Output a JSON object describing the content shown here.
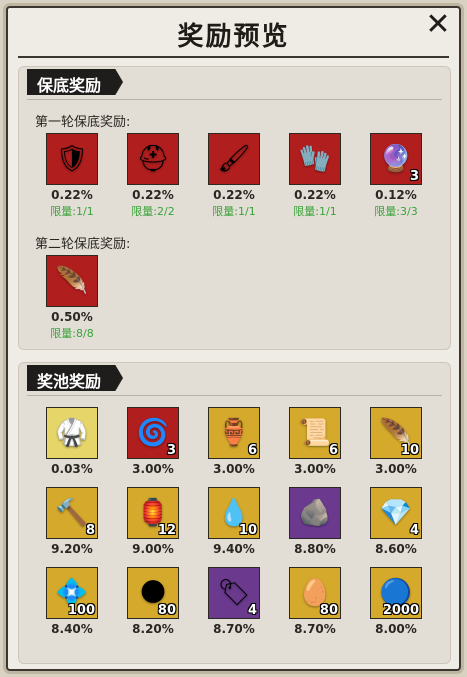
{
  "window": {
    "title": "奖励预览",
    "close_icon": "close-icon"
  },
  "guarantee": {
    "header": "保底奖励",
    "round1": {
      "label": "第一轮保底奖励:",
      "items": [
        {
          "icon": "armor-icon",
          "glyph": "🛡",
          "color": "#b01e1e",
          "count": "",
          "pct": "0.22%",
          "limit": "限量:1/1"
        },
        {
          "icon": "helmet-icon",
          "glyph": "⛑",
          "color": "#b01e1e",
          "count": "",
          "pct": "0.22%",
          "limit": "限量:2/2"
        },
        {
          "icon": "brush-icon",
          "glyph": "🖌",
          "color": "#b01e1e",
          "count": "",
          "pct": "0.22%",
          "limit": "限量:1/1"
        },
        {
          "icon": "gauntlet-icon",
          "glyph": "🧤",
          "color": "#b01e1e",
          "count": "",
          "pct": "0.22%",
          "limit": "限量:1/1"
        },
        {
          "icon": "orb-icon",
          "glyph": "🔮",
          "color": "#b01e1e",
          "count": "3",
          "pct": "0.12%",
          "limit": "限量:3/3"
        }
      ]
    },
    "round2": {
      "label": "第二轮保底奖励:",
      "items": [
        {
          "icon": "golden-wing-icon",
          "glyph": "🪶",
          "color": "#b01e1e",
          "count": "",
          "pct": "0.50%",
          "limit": "限量:8/8"
        }
      ]
    }
  },
  "pool": {
    "header": "奖池奖励",
    "items": [
      {
        "icon": "armor-set-icon",
        "glyph": "🥋",
        "color": "#e6d66a",
        "count": "",
        "pct": "0.03%"
      },
      {
        "icon": "swirl-token-icon",
        "glyph": "🌀",
        "color": "#b01e1e",
        "count": "3",
        "pct": "3.00%"
      },
      {
        "icon": "potion-jar-icon",
        "glyph": "🏺",
        "color": "#d4a92c",
        "count": "6",
        "pct": "3.00%"
      },
      {
        "icon": "scroll-ticket-icon",
        "glyph": "📜",
        "color": "#d4a92c",
        "count": "6",
        "pct": "3.00%"
      },
      {
        "icon": "gold-fragment-icon",
        "glyph": "🪶",
        "color": "#d4a92c",
        "count": "10",
        "pct": "3.00%"
      },
      {
        "icon": "hammer-icon",
        "glyph": "🔨",
        "color": "#d4a92c",
        "count": "8",
        "pct": "9.20%"
      },
      {
        "icon": "incense-pot-icon",
        "glyph": "🏮",
        "color": "#d4a92c",
        "count": "12",
        "pct": "9.00%"
      },
      {
        "icon": "spirit-flame-icon",
        "glyph": "💧",
        "color": "#d4a92c",
        "count": "10",
        "pct": "9.40%"
      },
      {
        "icon": "ore-crystal-icon",
        "glyph": "🪨",
        "color": "#6b3a8f",
        "count": "",
        "pct": "8.80%"
      },
      {
        "icon": "red-gem-icon",
        "glyph": "💎",
        "color": "#d4a92c",
        "count": "4",
        "pct": "8.60%"
      },
      {
        "icon": "pink-crystal-icon",
        "glyph": "💠",
        "color": "#d4a92c",
        "count": "100",
        "pct": "8.40%"
      },
      {
        "icon": "dark-ore-icon",
        "glyph": "🌑",
        "color": "#d4a92c",
        "count": "80",
        "pct": "8.20%"
      },
      {
        "icon": "jade-scroll-icon",
        "glyph": "🏷",
        "color": "#6b3a8f",
        "count": "4",
        "pct": "8.70%"
      },
      {
        "icon": "egg-icon",
        "glyph": "🥚",
        "color": "#d4a92c",
        "count": "80",
        "pct": "8.70%"
      },
      {
        "icon": "blue-orb-icon",
        "glyph": "🔵",
        "color": "#d4a92c",
        "count": "2000",
        "pct": "8.00%"
      }
    ]
  }
}
